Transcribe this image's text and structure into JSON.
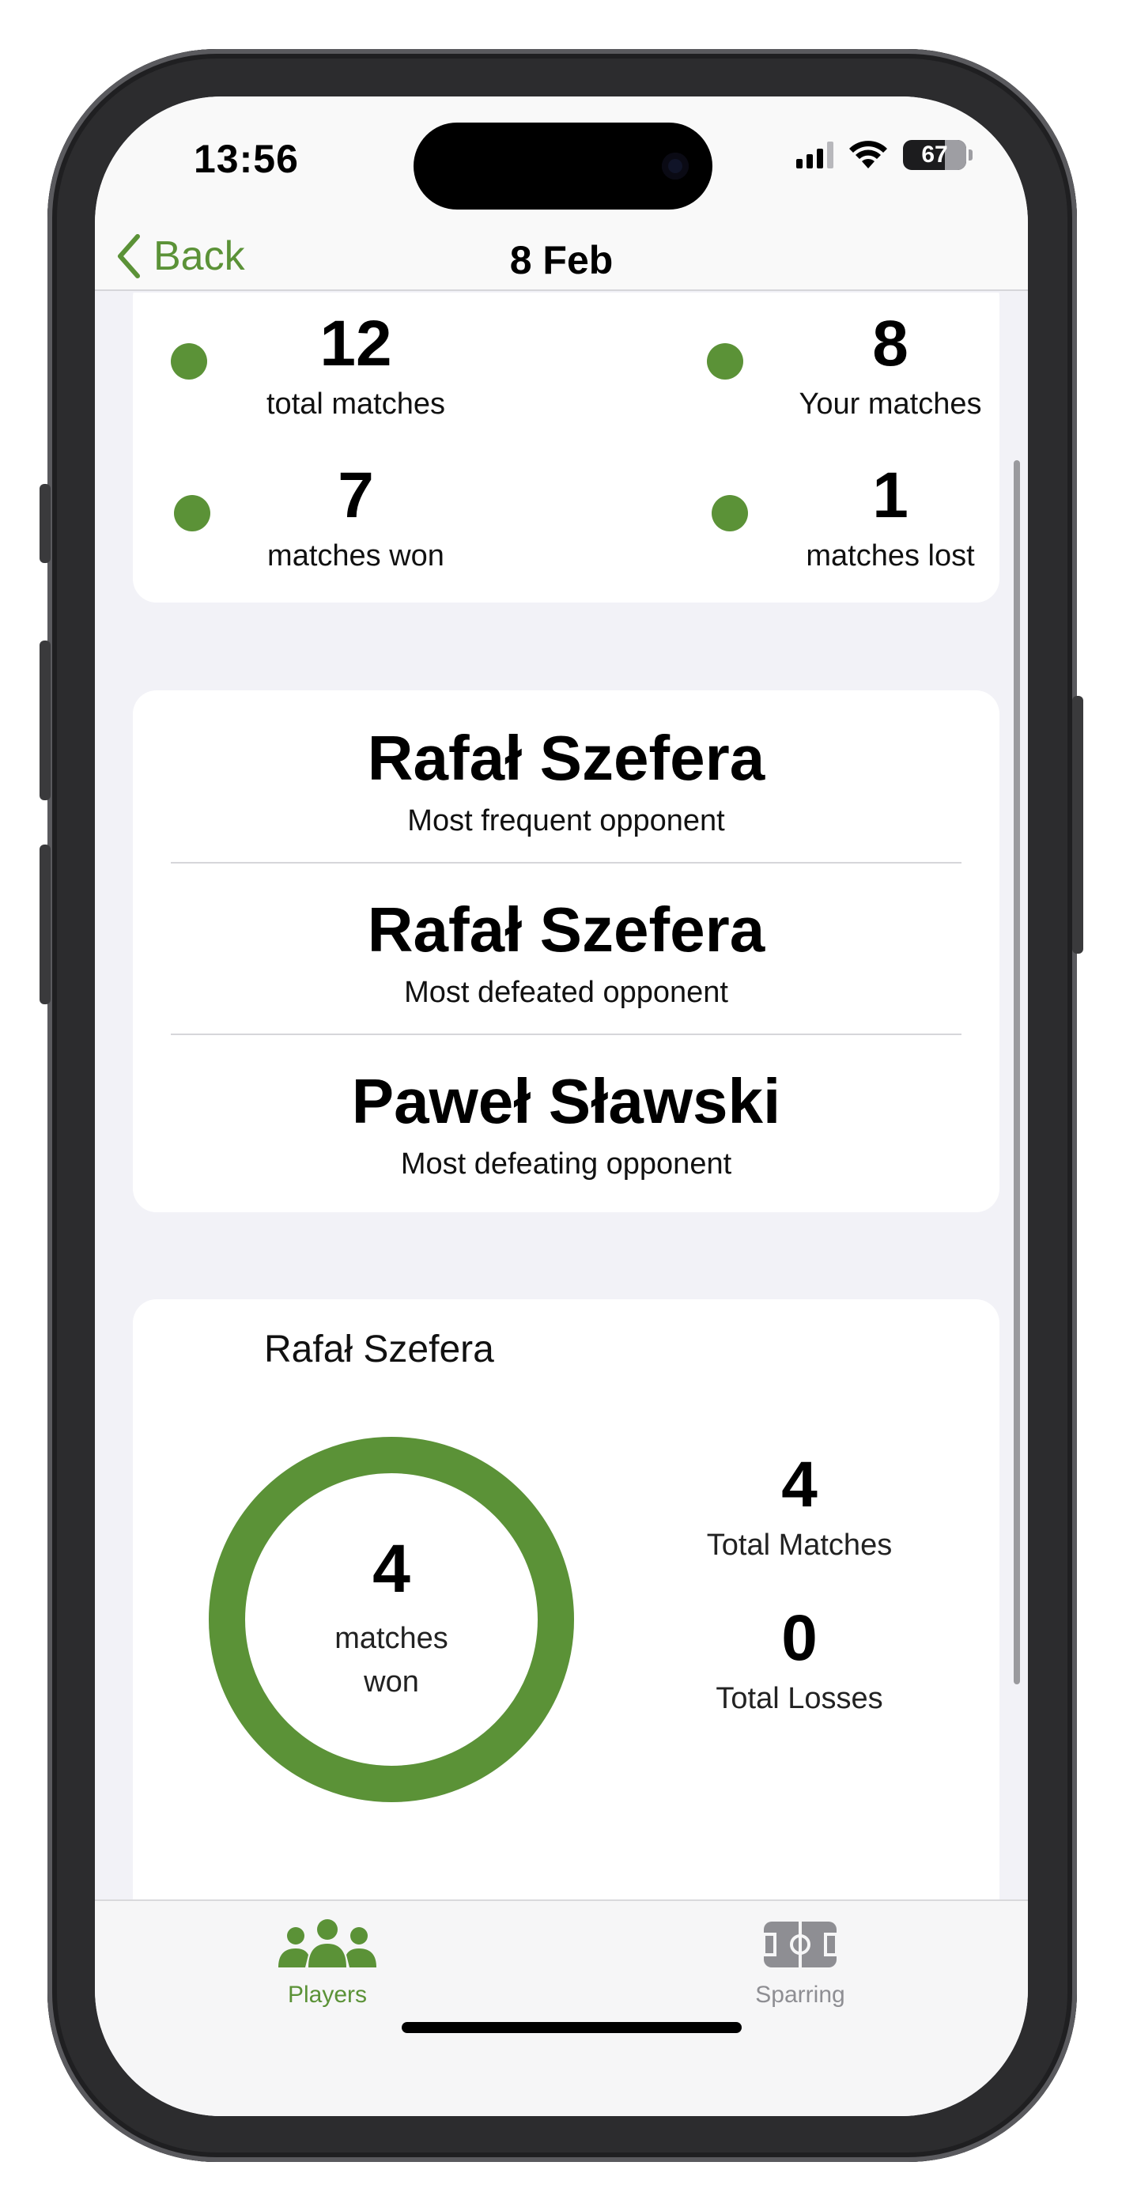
{
  "status_bar": {
    "time": "13:56",
    "battery": "67"
  },
  "nav": {
    "back_label": "Back",
    "title": "8 Feb"
  },
  "stats": {
    "total_matches": {
      "value": "12",
      "label": "total matches"
    },
    "your_matches": {
      "value": "8",
      "label": "Your matches"
    },
    "matches_won": {
      "value": "7",
      "label": "matches won"
    },
    "matches_lost": {
      "value": "1",
      "label": "matches lost"
    }
  },
  "opponents": [
    {
      "name": "Rafał Szefera",
      "label": "Most frequent opponent"
    },
    {
      "name": "Rafał Szefera",
      "label": "Most defeated opponent"
    },
    {
      "name": "Paweł Sławski",
      "label": "Most defeating opponent"
    }
  ],
  "head_to_head": {
    "opponent": "Rafał Szefera",
    "won_value": "4",
    "won_label": "matches won",
    "won_fraction": 1.0,
    "total_matches": {
      "value": "4",
      "label": "Total Matches"
    },
    "total_losses": {
      "value": "0",
      "label": "Total Losses"
    }
  },
  "tabs": [
    {
      "label": "Players",
      "icon": "players-icon",
      "active": true
    },
    {
      "label": "Sparring",
      "icon": "sparring-field-icon",
      "active": false
    }
  ],
  "colors": {
    "accent": "#5b9237",
    "background": "#f2f2f7",
    "inactive": "#8e8e93"
  }
}
